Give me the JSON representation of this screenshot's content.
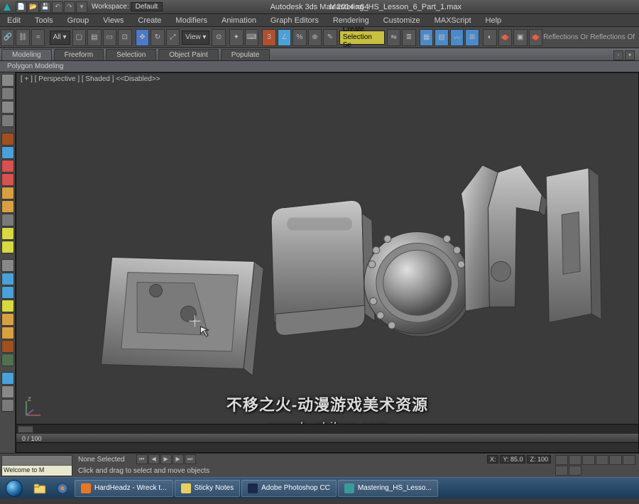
{
  "app": {
    "title": "Autodesk 3ds Max 2014 x64",
    "filename": "Mastering_HS_Lesson_6_Part_1.max"
  },
  "workspace": {
    "label": "Workspace:",
    "value": "Default"
  },
  "menu": [
    "Edit",
    "Tools",
    "Group",
    "Views",
    "Create",
    "Modifiers",
    "Animation",
    "Graph Editors",
    "Rendering",
    "Customize",
    "MAXScript",
    "Help"
  ],
  "toolbar": {
    "selset_field": "Create Selection Se",
    "view_label": "View",
    "reflections_label": "Reflections Or Reflections Of"
  },
  "ribbon": {
    "tabs": [
      "Modeling",
      "Freeform",
      "Selection",
      "Object Paint",
      "Populate"
    ],
    "active": 0,
    "subpanel": "Polygon Modeling"
  },
  "viewport": {
    "label": "[ + ] [ Perspective ] [ Shaded ]    <<Disabled>>",
    "time_position": "0 / 100"
  },
  "status": {
    "welcome": "Welcome to M",
    "selection": "None Selected",
    "prompt": "Click and drag to select and move objects",
    "coords": {
      "x": "X:",
      "y": "Y: 85.0",
      "z": "Z: 100"
    }
  },
  "watermark": {
    "line1": "不移之火-动漫游戏美术资源",
    "line2": "www.byzhihuo.com"
  },
  "taskbar": {
    "items": [
      {
        "label": "HardHeadz - Wreck t...",
        "color": "#e87722"
      },
      {
        "label": "Sticky Notes",
        "color": "#e8d060"
      },
      {
        "label": "Adobe Photoshop CC",
        "color": "#1a2a4a"
      },
      {
        "label": "Mastering_HS_Lesso...",
        "color": "#3a9a9a"
      }
    ]
  },
  "left_icons": [
    "c2",
    "c1",
    "c2",
    "c1",
    "c8",
    "c3",
    "c4",
    "c4",
    "c5",
    "c5",
    "c1",
    "c7",
    "c7",
    "c2",
    "c3",
    "c3",
    "c7",
    "c5",
    "c5",
    "c1",
    "c3",
    "c2",
    "c1"
  ]
}
